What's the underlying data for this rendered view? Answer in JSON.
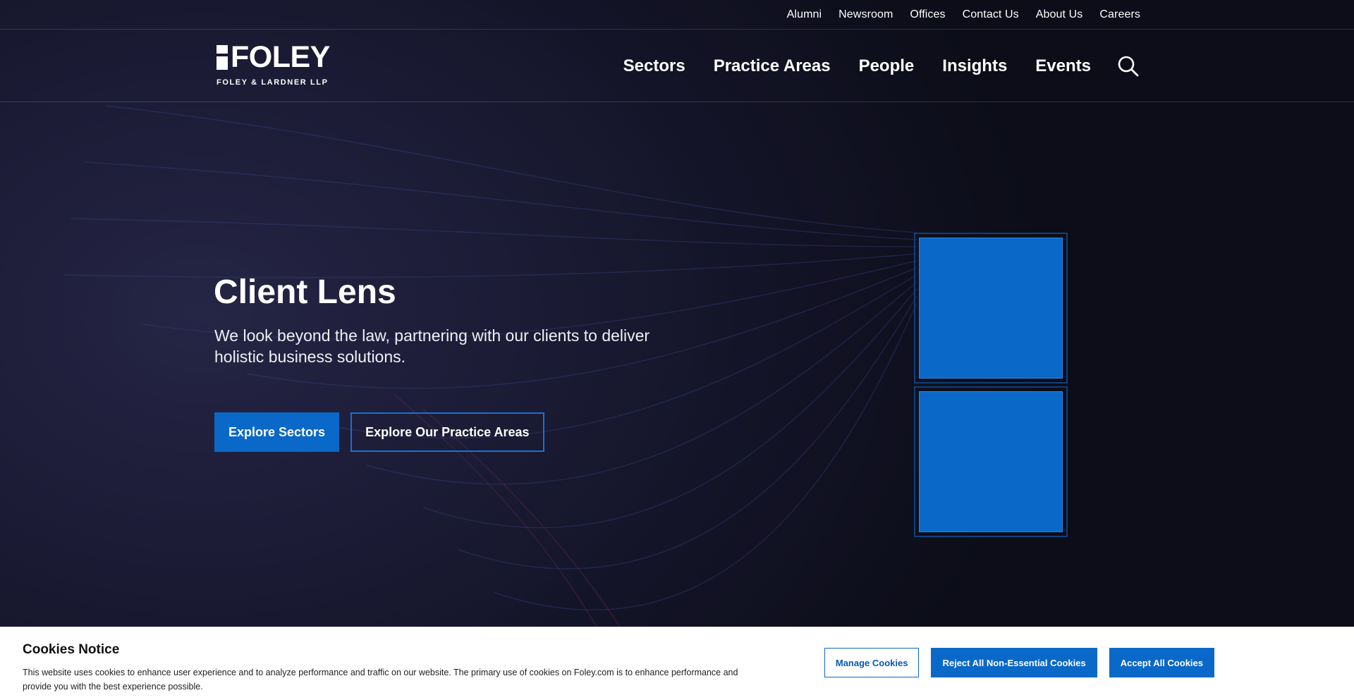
{
  "utility_nav": {
    "links": [
      "Alumni",
      "Newsroom",
      "Offices",
      "Contact Us",
      "About Us",
      "Careers"
    ]
  },
  "logo": {
    "wordmark": "FOLEY",
    "subtitle": "FOLEY & LARDNER LLP"
  },
  "main_nav": {
    "links": [
      "Sectors",
      "Practice Areas",
      "People",
      "Insights",
      "Events"
    ],
    "search_icon": "search-icon"
  },
  "hero": {
    "title": "Client Lens",
    "subtitle": "We look beyond the law, partnering with our clients to deliver holistic business solutions.",
    "primary_button": "Explore Sectors",
    "secondary_button": "Explore Our Practice Areas"
  },
  "cookie_notice": {
    "title": "Cookies Notice",
    "text": "This website uses cookies to enhance user experience and to analyze performance and traffic on our website. The primary use of cookies on Foley.com is to enhance performance and provide you with the best experience possible.",
    "manage_button": "Manage Cookies",
    "reject_button": "Reject All Non-Essential Cookies",
    "accept_button": "Accept All Cookies"
  },
  "colors": {
    "accent": "#0a68c9",
    "background": "#1c1c37",
    "text": "#ffffff"
  }
}
